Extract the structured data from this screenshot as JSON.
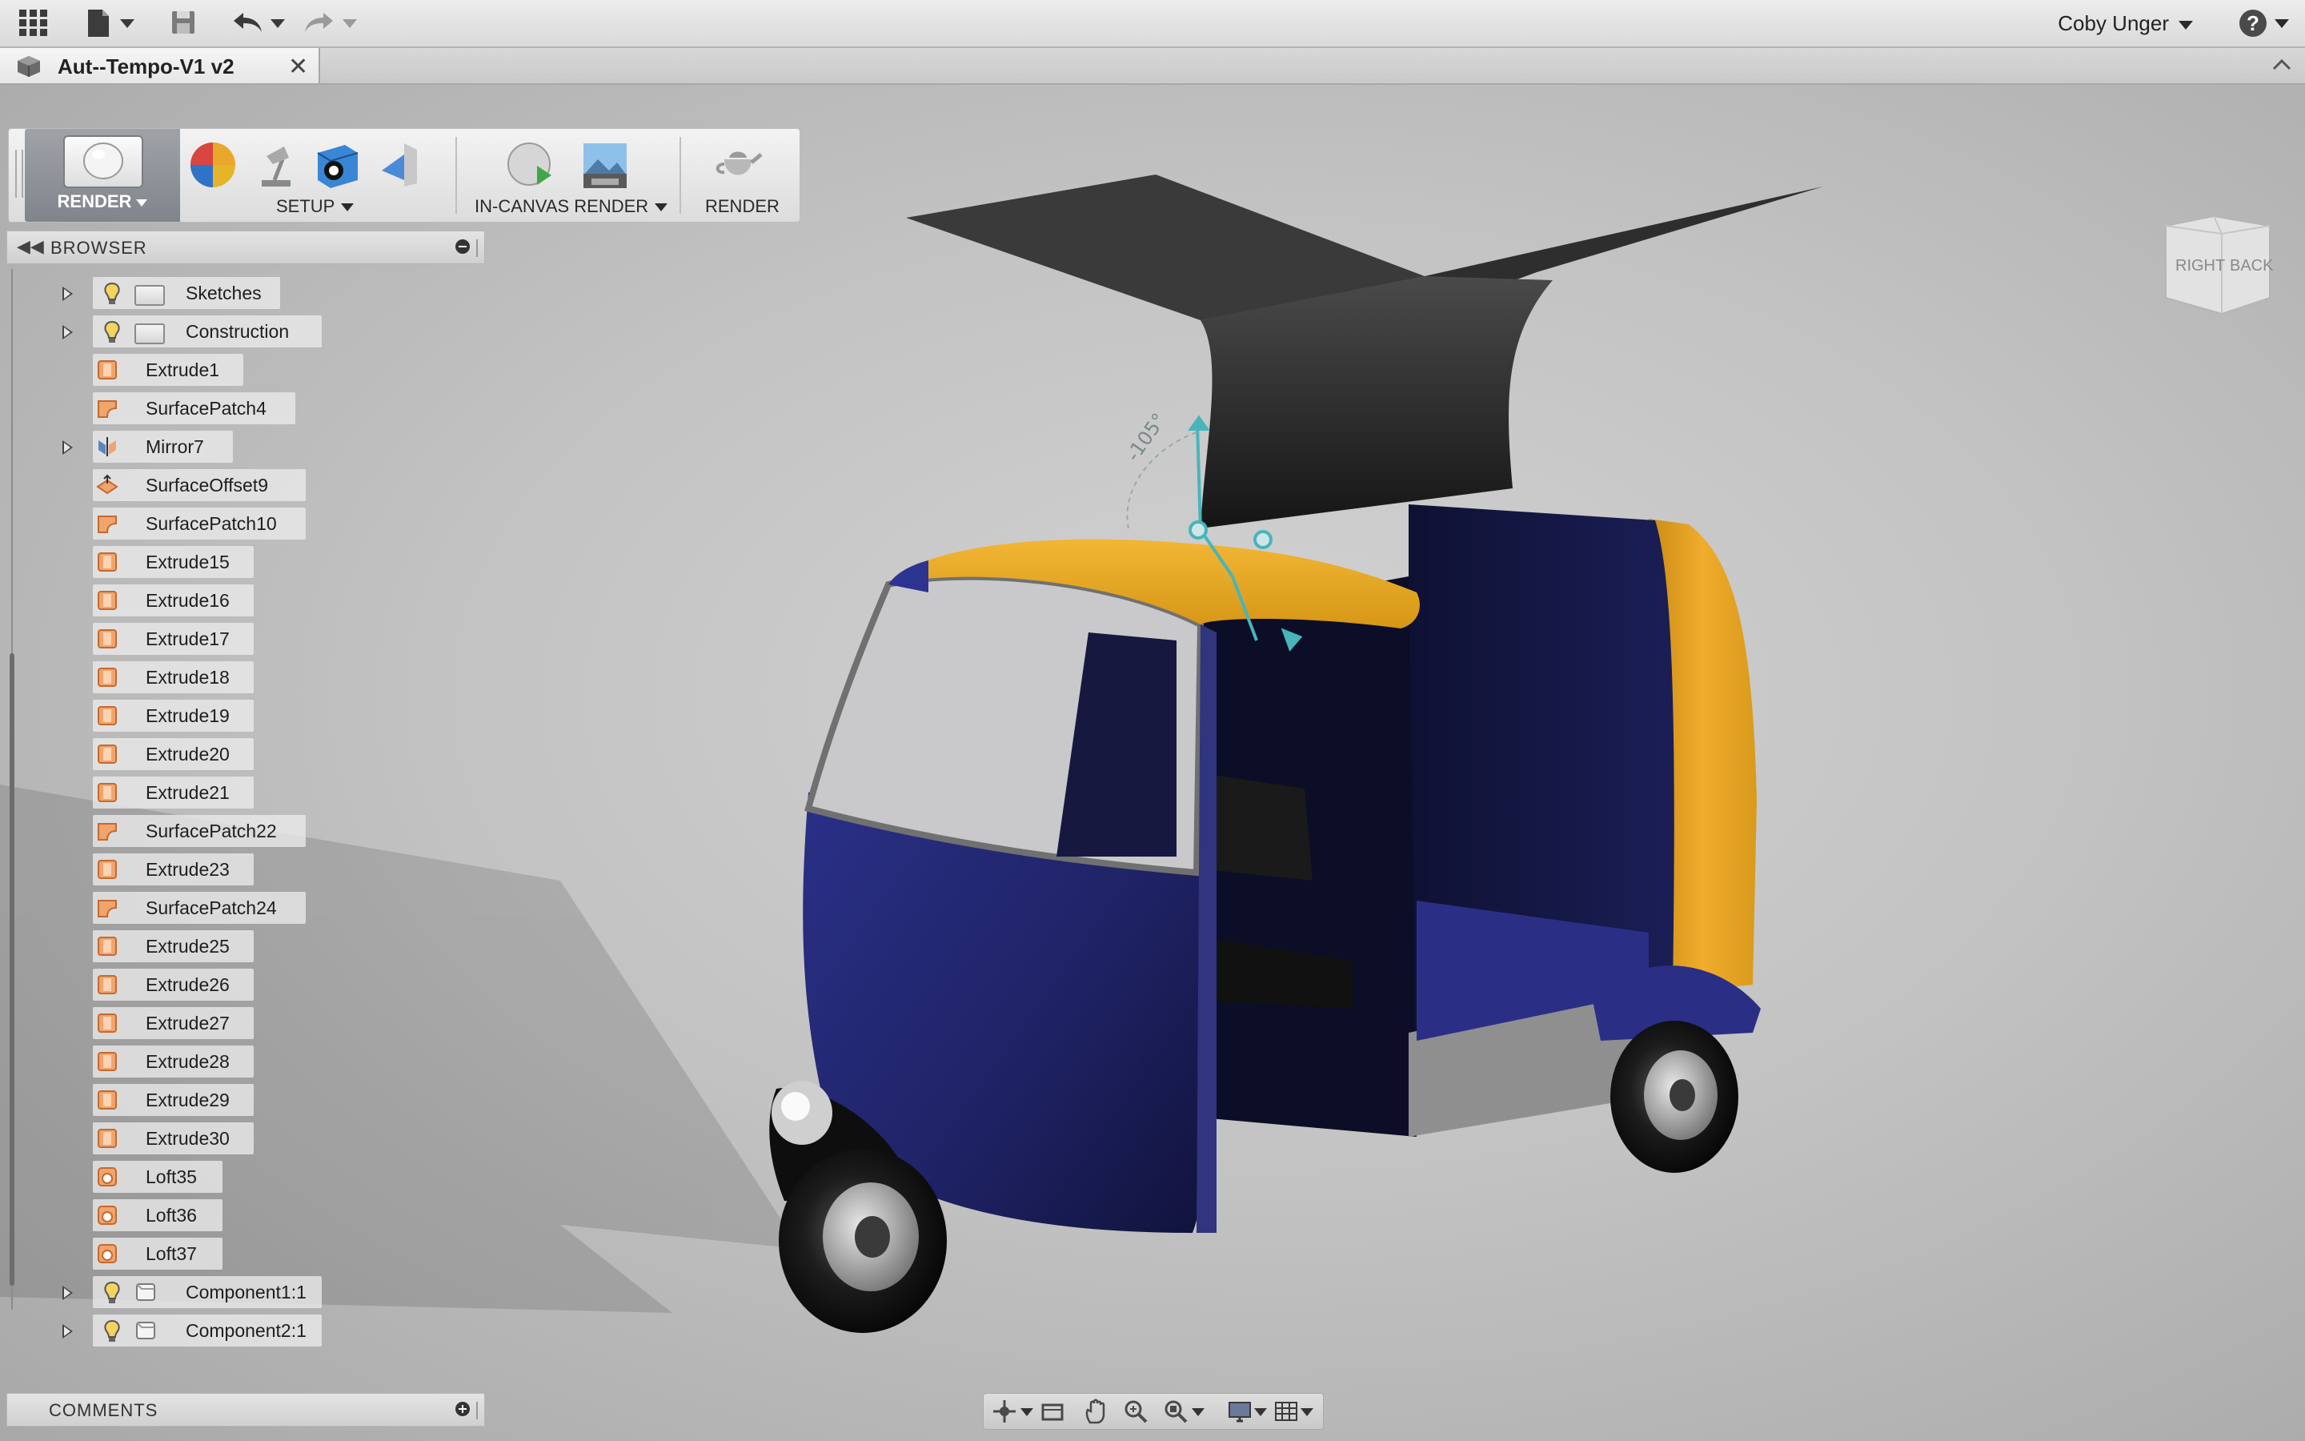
{
  "topbar": {
    "user_name": "Coby Unger",
    "icons": [
      "app-grid-icon",
      "file-icon",
      "save-icon",
      "undo-icon",
      "redo-icon",
      "help-icon"
    ]
  },
  "document_tab": {
    "title": "Aut--Tempo-V1 v2",
    "close": "✕"
  },
  "toolbar": {
    "workspace_label": "RENDER",
    "groups": {
      "setup": "SETUP",
      "in_canvas_render": "IN-CANVAS RENDER",
      "render": "RENDER"
    }
  },
  "browser": {
    "title": "BROWSER",
    "items": [
      {
        "label": "Sketches",
        "type": "folder"
      },
      {
        "label": "Construction",
        "type": "folder"
      },
      {
        "label": "Extrude1",
        "type": "extrude"
      },
      {
        "label": "SurfacePatch4",
        "type": "patch"
      },
      {
        "label": "Mirror7",
        "type": "mirror"
      },
      {
        "label": "SurfaceOffset9",
        "type": "offset"
      },
      {
        "label": "SurfacePatch10",
        "type": "patch"
      },
      {
        "label": "Extrude15",
        "type": "extrude"
      },
      {
        "label": "Extrude16",
        "type": "extrude"
      },
      {
        "label": "Extrude17",
        "type": "extrude"
      },
      {
        "label": "Extrude18",
        "type": "extrude"
      },
      {
        "label": "Extrude19",
        "type": "extrude"
      },
      {
        "label": "Extrude20",
        "type": "extrude"
      },
      {
        "label": "Extrude21",
        "type": "extrude"
      },
      {
        "label": "SurfacePatch22",
        "type": "patch"
      },
      {
        "label": "Extrude23",
        "type": "extrude"
      },
      {
        "label": "SurfacePatch24",
        "type": "patch"
      },
      {
        "label": "Extrude25",
        "type": "extrude"
      },
      {
        "label": "Extrude26",
        "type": "extrude"
      },
      {
        "label": "Extrude27",
        "type": "extrude"
      },
      {
        "label": "Extrude28",
        "type": "extrude"
      },
      {
        "label": "Extrude29",
        "type": "extrude"
      },
      {
        "label": "Extrude30",
        "type": "extrude"
      },
      {
        "label": "Loft35",
        "type": "loft"
      },
      {
        "label": "Loft36",
        "type": "loft"
      },
      {
        "label": "Loft37",
        "type": "loft"
      },
      {
        "label": "Component1:1",
        "type": "component"
      },
      {
        "label": "Component2:1",
        "type": "component"
      }
    ]
  },
  "comments": {
    "title": "COMMENTS"
  },
  "viewcube": {
    "faces": [
      "RIGHT",
      "BACK"
    ]
  },
  "canvas": {
    "angle_label": "-105°"
  },
  "colors": {
    "body_blue": "#1f2366",
    "roof_yellow": "#e6a322",
    "canopy": "#2a2a2a",
    "feature_orange": "#f0a46e",
    "workspace_button": "#8d9196"
  }
}
